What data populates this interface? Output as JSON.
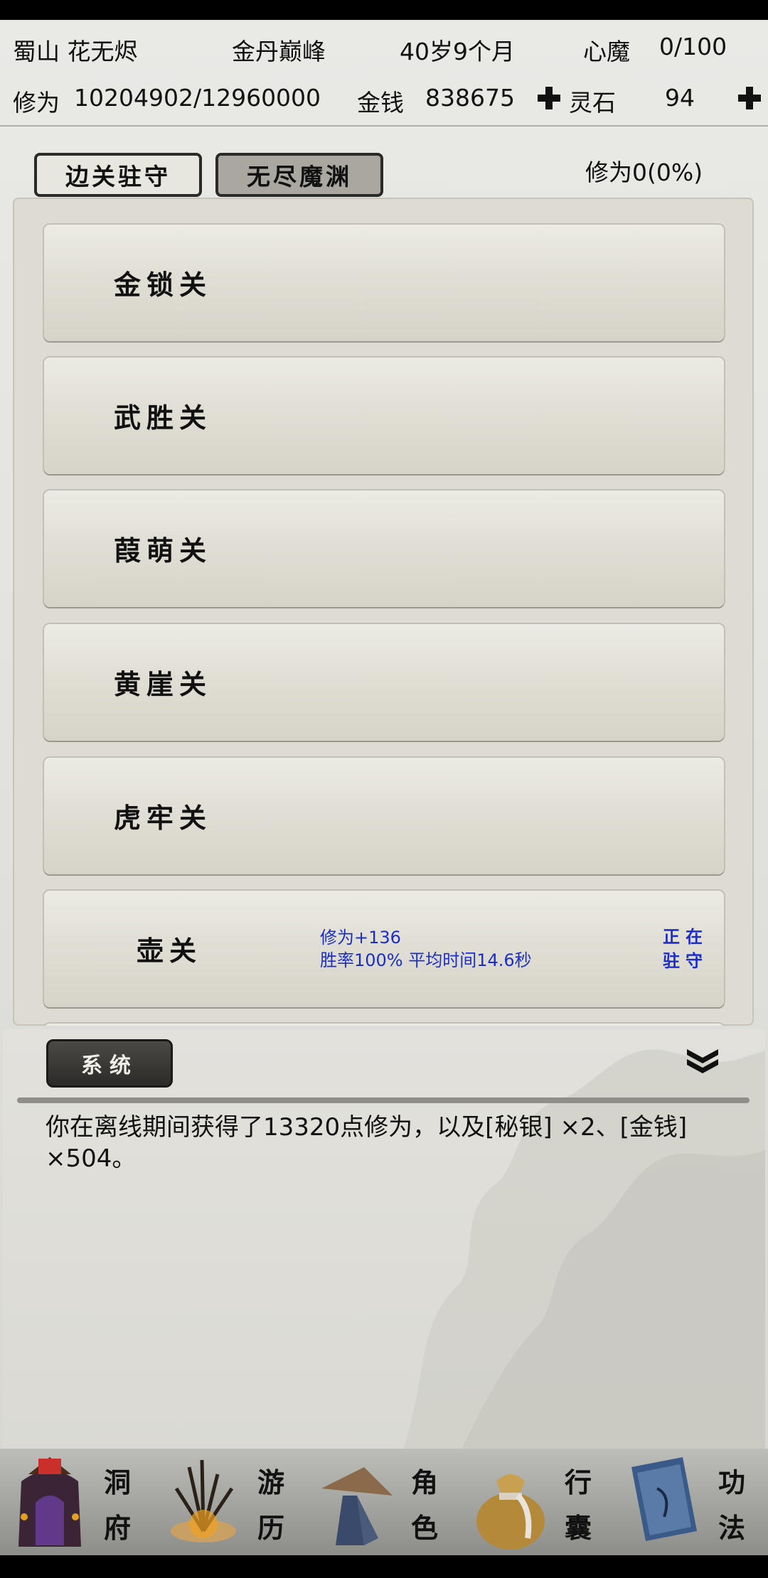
{
  "header": {
    "sect_name": "蜀山 花无烬",
    "realm": "金丹巅峰",
    "age": "40岁9个月",
    "heart_demon_label": "心魔",
    "heart_demon_value": "0/100",
    "cultivation_label": "修为",
    "cultivation_value": "10204902/12960000",
    "money_label": "金钱",
    "money_value": "838675",
    "spirit_stone_label": "灵石",
    "spirit_stone_value": "94"
  },
  "tabs": [
    {
      "label": "边关驻守",
      "active": true
    },
    {
      "label": "无尽魔渊",
      "active": false
    }
  ],
  "progress_label": "修为0(0%)",
  "passes": [
    {
      "name": "金锁关"
    },
    {
      "name": "武胜关"
    },
    {
      "name": "葭萌关"
    },
    {
      "name": "黄崖关"
    },
    {
      "name": "虎牢关"
    },
    {
      "name": "壶关",
      "info_line1": "修为+136",
      "info_line2": "胜率100% 平均时间14.6秒",
      "status_line1": "正在",
      "status_line2": "驻守"
    }
  ],
  "log": {
    "tab_label": "系统",
    "message": "你在离线期间获得了13320点修为，以及[秘银] ×2、[金钱] ×504。"
  },
  "nav": [
    {
      "label_top": "洞",
      "label_bottom": "府",
      "icon": "cave-dwelling-icon"
    },
    {
      "label_top": "游",
      "label_bottom": "历",
      "icon": "travel-icon"
    },
    {
      "label_top": "角",
      "label_bottom": "色",
      "icon": "character-icon"
    },
    {
      "label_top": "行",
      "label_bottom": "囊",
      "icon": "bag-icon"
    },
    {
      "label_top": "功",
      "label_bottom": "法",
      "icon": "skill-book-icon"
    }
  ],
  "colors": {
    "info_blue": "#1c2ec8",
    "tab_dark": "#2c2b29"
  }
}
